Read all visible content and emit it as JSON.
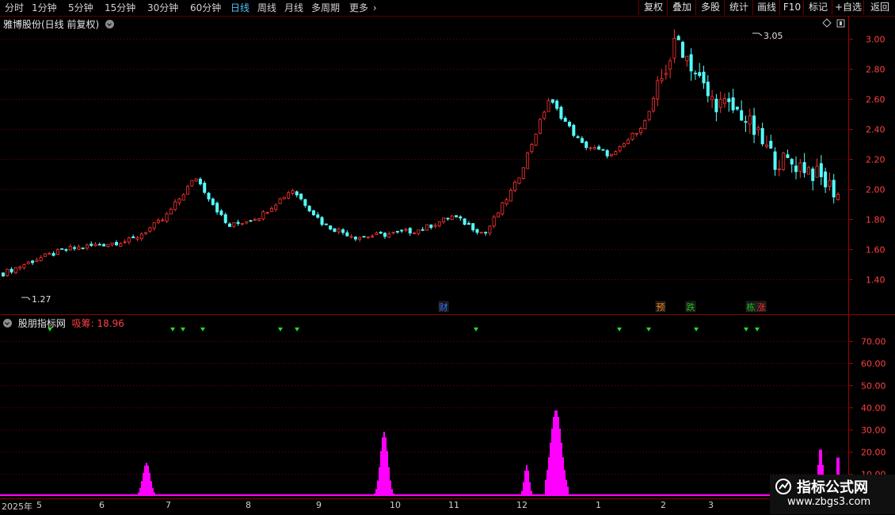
{
  "toolbar": {
    "periods": [
      "分时",
      "1分钟",
      "5分钟",
      "15分钟",
      "30分钟",
      "60分钟",
      "日线",
      "周线",
      "月线",
      "多周期",
      "更多"
    ],
    "active_period": "日线",
    "right_buttons": [
      "复权",
      "叠加",
      "多股",
      "统计",
      "画线",
      "F10",
      "标记",
      "+自选",
      "返回"
    ]
  },
  "main_chart": {
    "title": "雅博股份(日线 前复权)",
    "price_axis": [
      "3.00",
      "2.80",
      "2.60",
      "2.40",
      "2.20",
      "2.00",
      "1.80",
      "1.60",
      "1.40"
    ],
    "high_label": "3.05",
    "low_label": "1.27",
    "event_markers": [
      {
        "text": "财",
        "color": "#3a78ff"
      },
      {
        "text": "预",
        "color": "#ff8c1a"
      },
      {
        "text": "跌",
        "color": "#22c322"
      },
      {
        "text": "栋",
        "color": "#22c322"
      },
      {
        "text": "涨",
        "color": "#ff3030"
      }
    ],
    "colors": {
      "up": "#ff3232",
      "down": "#54ffff",
      "grid": "#7a0000"
    }
  },
  "sub_chart": {
    "title": "股朋指标网",
    "indicator_label": "吸筹:",
    "indicator_value": "18.96",
    "value_axis": [
      "70.00",
      "60.00",
      "50.00",
      "40.00",
      "30.00",
      "20.00",
      "10.00"
    ],
    "bar_color": "#ff00ff",
    "signal_color": "#22dd22"
  },
  "date_axis": {
    "ticks": [
      "2025年",
      "5",
      "6",
      "7",
      "8",
      "9",
      "10",
      "11",
      "12",
      "1",
      "2",
      "3"
    ]
  },
  "watermark": {
    "line1": "指标公式网",
    "line2": "www.zbgs3.com"
  },
  "chart_data": [
    {
      "type": "candlestick",
      "title": "雅博股份(日线 前复权)",
      "ylim": [
        1.27,
        3.05
      ],
      "x": [
        "2025-04",
        "2025-05",
        "2025-06",
        "2025-07",
        "2025-08",
        "2025-09",
        "2025-10",
        "2025-11",
        "2025-12",
        "2026-01",
        "2026-02",
        "2026-03"
      ],
      "series": [
        {
          "name": "close",
          "values": [
            1.44,
            1.53,
            1.6,
            1.63,
            1.66,
            1.8,
            2.08,
            1.75,
            1.82,
            2.0,
            1.76,
            1.68,
            1.7,
            1.73,
            1.82,
            1.7,
            2.05,
            2.6,
            2.3,
            2.22,
            2.45,
            3.0,
            2.6,
            2.5,
            2.2,
            2.15,
            1.97
          ]
        }
      ],
      "annotations": [
        "3.05",
        "1.27"
      ]
    },
    {
      "type": "bar",
      "title": "股朋指标网",
      "ylim": [
        0,
        75
      ],
      "series": [
        {
          "name": "吸筹",
          "peaks": [
            {
              "month": "6",
              "value": 15
            },
            {
              "month": "10",
              "value": 29
            },
            {
              "month": "12",
              "value": 14
            },
            {
              "month": "12",
              "value": 39
            },
            {
              "month": "3",
              "value": 22
            },
            {
              "month": "3",
              "value": 18.96
            }
          ]
        }
      ]
    }
  ]
}
